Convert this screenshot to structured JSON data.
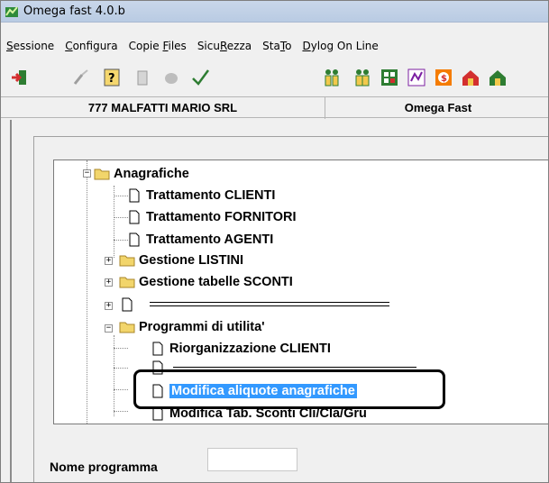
{
  "window": {
    "title": "Omega fast 4.0.b"
  },
  "menu": [
    {
      "pre": "",
      "ul": "S",
      "post": "essione"
    },
    {
      "pre": "",
      "ul": "C",
      "post": "onfigura"
    },
    {
      "pre": "Copie ",
      "ul": "F",
      "post": "iles"
    },
    {
      "pre": "Sicu",
      "ul": "R",
      "post": "ezza"
    },
    {
      "pre": "Sta",
      "ul": "T",
      "post": "o"
    },
    {
      "pre": "",
      "ul": "D",
      "post": "ylog On Line"
    }
  ],
  "toolbar": {
    "icons": [
      "exit-icon",
      "broom-icon",
      "help-icon",
      "trash-icon",
      "bug-icon",
      "check-icon",
      "users-icon",
      "user-group-icon",
      "grid-icon",
      "currency-icon",
      "money-icon",
      "house-icon",
      "house-money-icon"
    ]
  },
  "status": {
    "company": "777 MALFATTI MARIO SRL",
    "app": "Omega Fast"
  },
  "tree": {
    "anagrafiche": "Anagrafiche",
    "clienti": "Trattamento CLIENTI",
    "fornitori": "Trattamento FORNITORI",
    "agenti": "Trattamento AGENTI",
    "listini": "Gestione LISTINI",
    "sconti": "Gestione tabelle SCONTI",
    "utilita": "Programmi di utilita'",
    "riorg": "Riorganizzazione CLIENTI",
    "modifica": "Modifica aliquote anagrafiche",
    "modtab": "Modifica Tab. Sconti Cli/Cla/Gru"
  },
  "form": {
    "label": "Nome programma",
    "value": ""
  },
  "colors": {
    "selection": "#3399ff",
    "folder": "#f2d56b",
    "titlebar": "#b9cbe3"
  }
}
